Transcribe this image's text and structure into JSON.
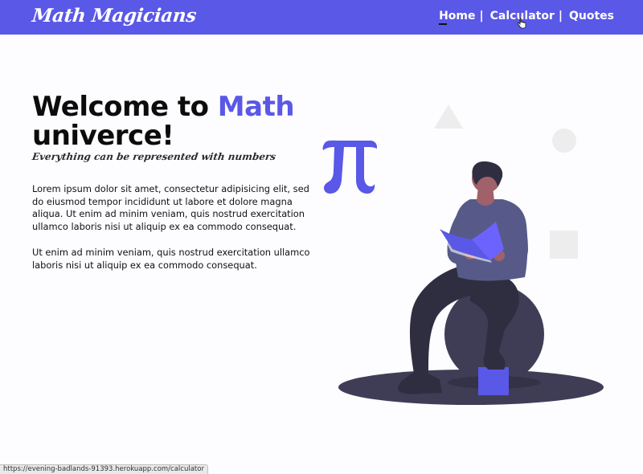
{
  "nav": {
    "logo": "Math Magicians",
    "links": [
      {
        "label": "Home",
        "active": true
      },
      {
        "label": "Calculator",
        "active": false
      },
      {
        "label": "Quotes",
        "active": false
      }
    ],
    "separator": "|"
  },
  "hero": {
    "title_prefix": "Welcome to ",
    "title_accent": "Math",
    "title_suffix": "univerce!",
    "tagline": "Everything can be represented with numbers",
    "paragraphs": [
      "Lorem ipsum dolor sit amet, consectetur adipisicing elit, sed do eiusmod tempor incididunt ut labore et dolore magna aliqua. Ut enim ad minim veniam, quis nostrud exercitation ullamco laboris nisi ut aliquip ex ea commodo consequat.",
      "Ut enim ad minim veniam, quis nostrud exercitation ullamco laboris nisi ut aliquip ex ea commodo consequat."
    ]
  },
  "illustration": {
    "symbol": "π",
    "icons": [
      "triangle-shape",
      "circle-shape",
      "square-shape",
      "pi-symbol",
      "person-reading-book"
    ]
  },
  "status_bar": {
    "url": "https://evening-badlands-91393.herokuapp.com/calculator"
  },
  "colors": {
    "accent": "#5a58e6",
    "navbar": "#5a58e6",
    "background": "#fdfcfe",
    "dark_figure": "#3f3d56"
  }
}
